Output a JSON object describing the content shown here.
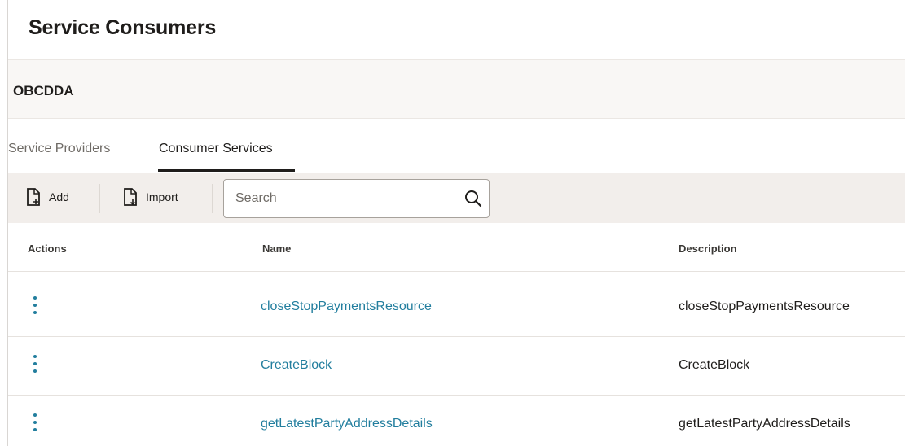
{
  "header": {
    "title": "Service Consumers"
  },
  "consumer": {
    "name": "OBCDDA"
  },
  "tabs": [
    {
      "label": "Service Providers",
      "selected": false
    },
    {
      "label": "Consumer Services",
      "selected": true
    }
  ],
  "toolbar": {
    "add_label": "Add",
    "add_icon": "add-document-icon",
    "import_label": "Import",
    "import_icon": "import-document-icon",
    "search": {
      "placeholder": "Search",
      "value": "",
      "icon": "search-icon"
    }
  },
  "table": {
    "columns": [
      "Actions",
      "Name",
      "Description"
    ],
    "rows": [
      {
        "name": "closeStopPaymentsResource",
        "description": "closeStopPaymentsResource"
      },
      {
        "name": "CreateBlock",
        "description": "CreateBlock"
      },
      {
        "name": "getLatestPartyAddressDetails",
        "description": "getLatestPartyAddressDetails"
      }
    ]
  },
  "colors": {
    "link": "#227e9e",
    "toolbar_bg": "#f2eeeb",
    "header_bar_bg": "#f9f7f5",
    "text": "#1f1d1b"
  }
}
